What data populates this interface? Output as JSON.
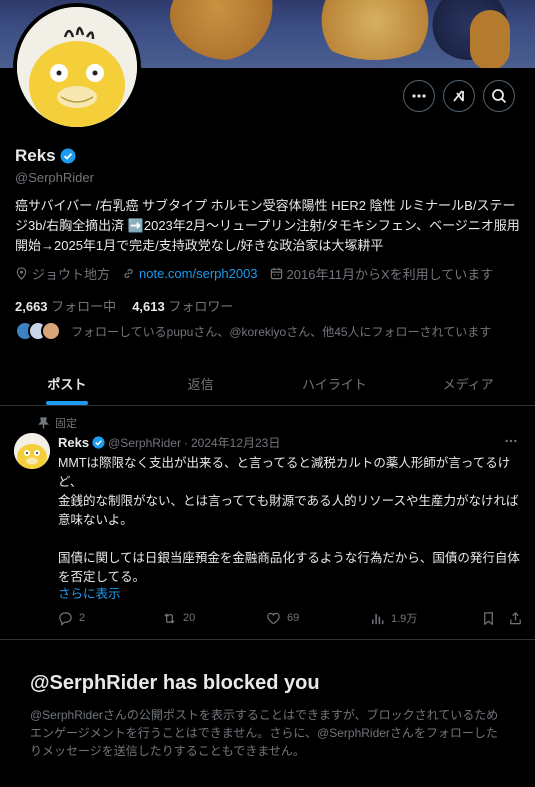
{
  "profile": {
    "display_name": "Reks",
    "handle": "@SerphRider",
    "bio": "癌サバイバー /右乳癌 サブタイプ ホルモン受容体陽性 HER2 陰性 ルミナールB/ステージ3b/右胸全摘出済 ➡️2023年2月～リュープリン注射/タモキシフェン、ベージニオ服用開始→2025年1月で完走/支持政党なし/好きな政治家は大塚耕平",
    "location": "ジョウト地方",
    "website": "note.com/serph2003",
    "joined": "2016年11月からXを利用しています",
    "following_count": "2,663",
    "following_label": "フォロー中",
    "followers_count": "4,613",
    "followers_label": "フォロワー",
    "followed_by": "フォローしているpupuさん、@korekiyoさん、他45人にフォローされています"
  },
  "icons": {
    "more": "more-icon",
    "grok": "grok-icon",
    "search": "search-icon",
    "verified": "verified-badge-icon",
    "location": "location-icon",
    "link": "link-icon",
    "calendar": "calendar-icon",
    "pin": "pin-icon",
    "reply": "reply-icon",
    "repost": "repost-icon",
    "like": "like-icon",
    "views": "views-icon",
    "bookmark": "bookmark-icon",
    "share": "share-icon"
  },
  "tabs": [
    {
      "label": "ポスト",
      "active": true
    },
    {
      "label": "返信",
      "active": false
    },
    {
      "label": "ハイライト",
      "active": false
    },
    {
      "label": "メディア",
      "active": false
    }
  ],
  "pinned_post": {
    "pinned_label": "固定",
    "author": "Reks",
    "handle": "@SerphRider",
    "separator": "·",
    "date": "2024年12月23日",
    "text": "MMTは際限なく支出が出来る、と言ってると減税カルトの薬人形師が言ってるけど、\n金銭的な制限がない、とは言ってても財源である人的リソースや生産力がなければ意味ないよ。\n\n国債に関しては日銀当座預金を金融商品化するような行為だから、国債の発行自体を否定してる。",
    "show_more": "さらに表示",
    "replies": "2",
    "reposts": "20",
    "likes": "69",
    "views": "1.9万"
  },
  "blocked": {
    "title": "@SerphRider has blocked you",
    "description": "@SerphRiderさんの公開ポストを表示することはできますが、ブロックされているためエンゲージメントを行うことはできません。さらに、@SerphRiderさんをフォローしたりメッセージを送信したりすることもできません。"
  },
  "colors": {
    "background": "#000000",
    "accent": "#1d9bf0",
    "text": "#e7e9ea",
    "muted": "#71767b",
    "border": "#2f3336"
  }
}
